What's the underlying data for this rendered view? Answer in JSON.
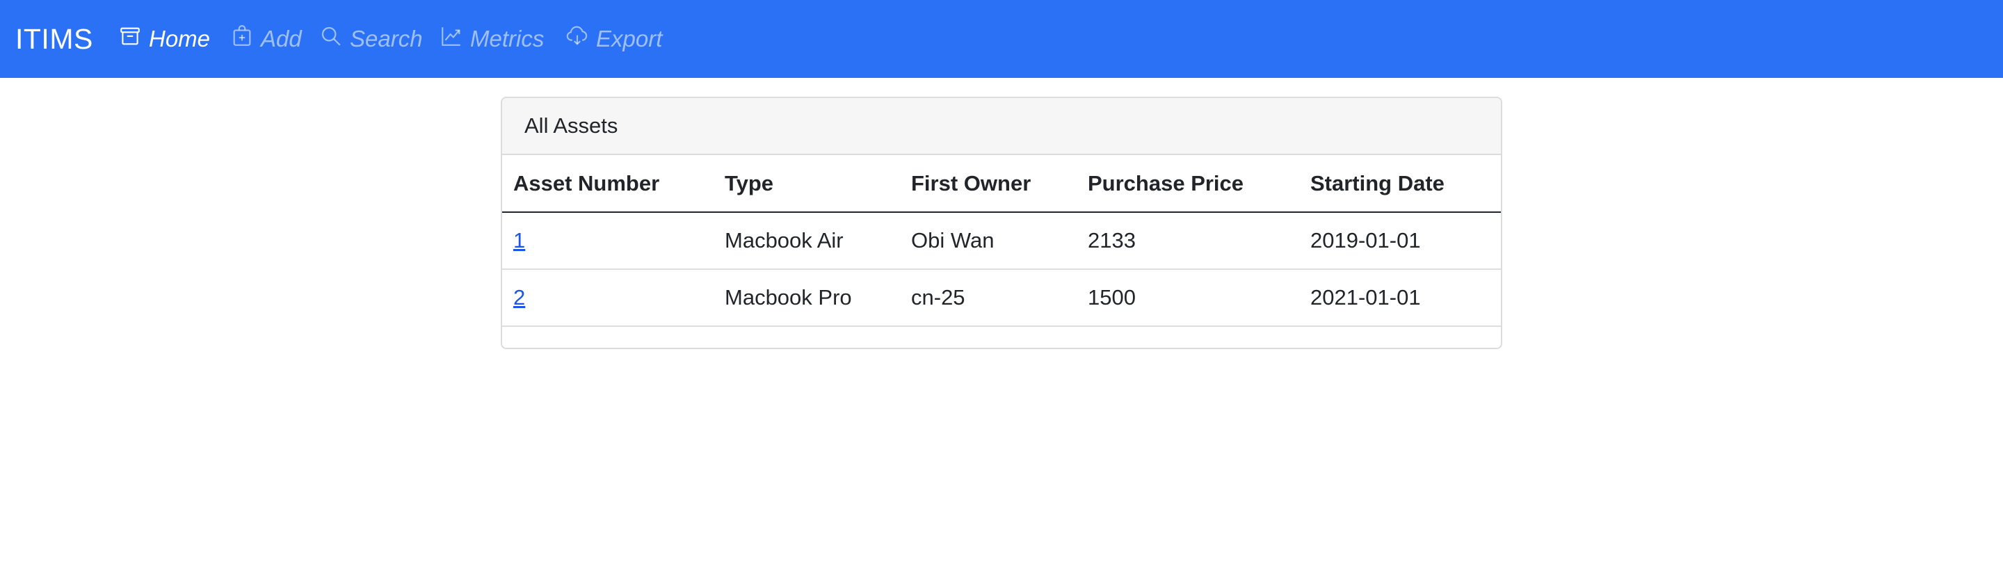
{
  "navbar": {
    "brand": "ITIMS",
    "items": [
      {
        "label": "Home",
        "icon": "archive-icon",
        "active": true
      },
      {
        "label": "Add",
        "icon": "add-bag-icon",
        "active": false
      },
      {
        "label": "Search",
        "icon": "search-icon",
        "active": false
      },
      {
        "label": "Metrics",
        "icon": "chart-line-icon",
        "active": false
      },
      {
        "label": "Export",
        "icon": "cloud-download-icon",
        "active": false
      }
    ],
    "color": "#2a71f5"
  },
  "card": {
    "title": "All Assets",
    "table": {
      "headers": [
        "Asset Number",
        "Type",
        "First Owner",
        "Purchase Price",
        "Starting Date"
      ],
      "rows": [
        {
          "asset_number": "1",
          "type": "Macbook Air",
          "first_owner": "Obi Wan",
          "purchase_price": "2133",
          "starting_date": "2019-01-01"
        },
        {
          "asset_number": "2",
          "type": "Macbook Pro",
          "first_owner": "cn-25",
          "purchase_price": "1500",
          "starting_date": "2021-01-01"
        }
      ]
    }
  }
}
